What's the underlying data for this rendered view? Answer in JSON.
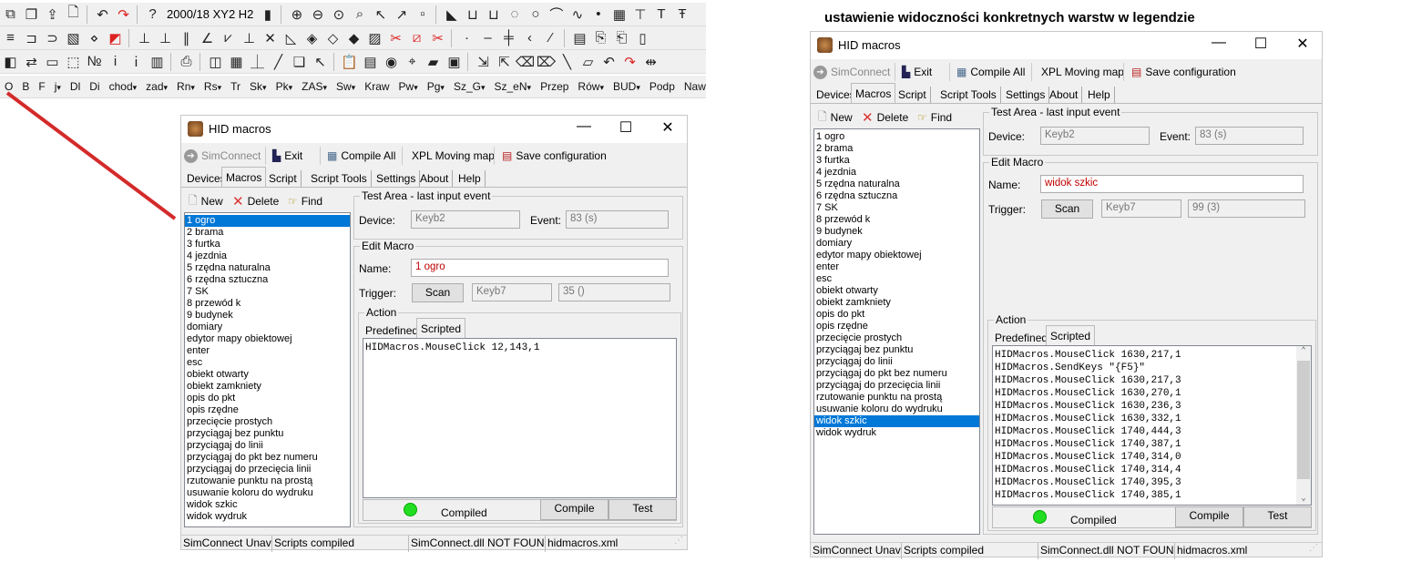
{
  "annotation": {
    "title": "ustawienie widoczności konkretnych warstw w legendzie",
    "arrow_color": "#d42a2a"
  },
  "app_toolbar": {
    "row1": [
      "copy-layers-icon",
      "window-cascade-icon",
      "export-icon",
      "document-icon",
      "|",
      "undo-icon",
      "redo-icon",
      "|",
      "help-icon",
      "TEXT",
      "exit-icon",
      "|",
      "zoom-in-icon",
      "zoom-out-icon",
      "zoom-fit-icon",
      "zoom-window-icon",
      "zoom-prev-icon",
      "zoom-next-icon",
      "frame-icon",
      "|",
      "shape-fill-icon",
      "shape-outline-icon",
      "shape-open-icon",
      "arc-dashed-icon",
      "circle-icon",
      "arc-icon",
      "curve-icon",
      "point-icon",
      "gradient-icon",
      "dimension-icon",
      "text-icon",
      "text-sub-icon"
    ],
    "row1_text": "2000/18 XY2 H2",
    "row2": [
      "line-style-icon",
      "polyline-end-icon",
      "polyline-arc-icon",
      "hatch-icon",
      "hatch-dropdown-icon",
      "fill-color-icon",
      "|",
      "perpendicular-icon",
      "perpendicular-base-icon",
      "parallel-icon",
      "angle-icon",
      "bisector-icon",
      "offset-icon",
      "intersect-icon",
      "area-icon",
      "diamond-hatch-icon",
      "diamond-icon",
      "rhombus-icon",
      "stripes-icon",
      "cut-icon",
      "square-cut-icon",
      "scissors-icon",
      "|",
      "point-on-line-icon",
      "midline-icon",
      "split-icon",
      "angle-point-icon",
      "extend-icon",
      "|",
      "table-icon",
      "copy-attr-icon",
      "paste-attr-icon",
      "attr-icon"
    ],
    "row3": [
      "layer-k1-icon",
      "swap-icon",
      "page-icon",
      "selection-icon",
      "numbering-icon",
      "info-icon",
      "info-list-icon",
      "sw-be-icon",
      "|",
      "print-icon",
      "|",
      "layers-icon",
      "grid-icon",
      "measure-icon",
      "line-icon",
      "copy-icon",
      "cursor-icon",
      "|",
      "clipboard-icon",
      "report-icon",
      "map-pin-icon",
      "gps-icon",
      "folder-image-icon",
      "save-doc-icon",
      "|",
      "import-icon",
      "export-layer-icon",
      "eraser-blue-icon",
      "eraser-icon",
      "line-diagonal-icon",
      "parallelogram-icon",
      "undo-yellow-icon",
      "redo-yellow-icon",
      "move-icon"
    ],
    "row4": [
      {
        "label": "O",
        "dd": false
      },
      {
        "label": "B",
        "dd": false
      },
      {
        "label": "F",
        "dd": false
      },
      {
        "label": "j",
        "dd": true
      },
      {
        "label": "Dl",
        "dd": false
      },
      {
        "label": "Di",
        "dd": false
      },
      {
        "label": "chod",
        "dd": true
      },
      {
        "label": "zad",
        "dd": true
      },
      {
        "label": "Rn",
        "dd": true
      },
      {
        "label": "Rs",
        "dd": true
      },
      {
        "label": "Tr",
        "dd": false
      },
      {
        "label": "Sk",
        "dd": true
      },
      {
        "label": "Pk",
        "dd": true
      },
      {
        "label": "ZAS",
        "dd": true
      },
      {
        "label": "Sw",
        "dd": true
      },
      {
        "label": "Kraw",
        "dd": false
      },
      {
        "label": "Pw",
        "dd": true
      },
      {
        "label": "Pg",
        "dd": true
      },
      {
        "label": "Sz_G",
        "dd": true
      },
      {
        "label": "Sz_eN",
        "dd": true
      },
      {
        "label": "Przep",
        "dd": false
      },
      {
        "label": "Rów",
        "dd": true
      },
      {
        "label": "BUD",
        "dd": true
      },
      {
        "label": "Podp",
        "dd": false
      },
      {
        "label": "Naw",
        "dd": false
      }
    ],
    "dropdown_glyph": "▾"
  },
  "windows": [
    {
      "title": "HID macros",
      "controls": {
        "minimize": "—",
        "maximize": "☐",
        "close": "✕"
      },
      "toolbar": {
        "simconnect": "SimConnect",
        "exit": "Exit",
        "compile_all": "Compile All",
        "xpl": "XPL Moving map",
        "save": "Save configuration"
      },
      "tabs": [
        "Devices",
        "Macros",
        "Script",
        "Script Tools",
        "Settings",
        "About",
        "Help"
      ],
      "active_tab": 1,
      "list_toolbar": {
        "new": "New",
        "delete": "Delete",
        "find": "Find"
      },
      "macros": [
        "1 ogro",
        "2 brama",
        "3 furtka",
        "4 jezdnia",
        "5 rzędna naturalna",
        "6 rzędna sztuczna",
        "7 SK",
        "8 przewód k",
        "9 budynek",
        "domiary",
        "edytor mapy obiektowej",
        "enter",
        "esc",
        "obiekt otwarty",
        "obiekt zamkniety",
        "opis do pkt",
        "opis rzędne",
        "przecięcie prostych",
        "przyciągaj bez punktu",
        "przyciągaj do linii",
        "przyciągaj do pkt bez numeru",
        "przyciągaj do przecięcia linii",
        "rzutowanie punktu na prostą",
        "usuwanie koloru do wydruku",
        "widok szkic",
        "widok wydruk"
      ],
      "selected_macro": 0,
      "test_area": {
        "label": "Test Area - last input event",
        "device_label": "Device:",
        "device": "Keyb2",
        "event_label": "Event:",
        "event": "83  (s)"
      },
      "edit": {
        "label": "Edit Macro",
        "name_label": "Name:",
        "name": "1 ogro",
        "trigger_label": "Trigger:",
        "scan": "Scan",
        "trigger_device": "Keyb7",
        "trigger_value": "35  ()"
      },
      "action": {
        "label": "Action",
        "tabs": [
          "Predefined",
          "Scripted"
        ],
        "active_tab": 1,
        "code": [
          "HIDMacros.MouseClick 12,143,1"
        ],
        "status": "Compiled",
        "compile": "Compile",
        "test": "Test",
        "has_scrollbar": false
      },
      "statusbar": [
        "SimConnect Unavai",
        "Scripts compiled",
        "SimConnect.dll NOT FOUNI",
        "hidmacros.xml"
      ]
    },
    {
      "title": "HID macros",
      "controls": {
        "minimize": "—",
        "maximize": "☐",
        "close": "✕"
      },
      "toolbar": {
        "simconnect": "SimConnect",
        "exit": "Exit",
        "compile_all": "Compile All",
        "xpl": "XPL Moving map",
        "save": "Save configuration"
      },
      "tabs": [
        "Devices",
        "Macros",
        "Script",
        "Script Tools",
        "Settings",
        "About",
        "Help"
      ],
      "active_tab": 1,
      "list_toolbar": {
        "new": "New",
        "delete": "Delete",
        "find": "Find"
      },
      "macros": [
        "1 ogro",
        "2 brama",
        "3 furtka",
        "4 jezdnia",
        "5 rzędna naturalna",
        "6 rzędna sztuczna",
        "7 SK",
        "8 przewód k",
        "9 budynek",
        "domiary",
        "edytor mapy obiektowej",
        "enter",
        "esc",
        "obiekt otwarty",
        "obiekt zamkniety",
        "opis do pkt",
        "opis rzędne",
        "przecięcie prostych",
        "przyciągaj bez punktu",
        "przyciągaj do linii",
        "przyciągaj do pkt bez numeru",
        "przyciągaj do przecięcia linii",
        "rzutowanie punktu na prostą",
        "usuwanie koloru do wydruku",
        "widok szkic",
        "widok wydruk"
      ],
      "selected_macro": 24,
      "test_area": {
        "label": "Test Area - last input event",
        "device_label": "Device:",
        "device": "Keyb2",
        "event_label": "Event:",
        "event": "83  (s)"
      },
      "edit": {
        "label": "Edit Macro",
        "name_label": "Name:",
        "name": "widok szkic",
        "trigger_label": "Trigger:",
        "scan": "Scan",
        "trigger_device": "Keyb7",
        "trigger_value": "99  (3)"
      },
      "action": {
        "label": "Action",
        "tabs": [
          "Predefined",
          "Scripted"
        ],
        "active_tab": 1,
        "code": [
          "HIDMacros.MouseClick 1630,217,1",
          "HIDMacros.SendKeys \"{F5}\"",
          "HIDMacros.MouseClick 1630,217,3",
          "HIDMacros.MouseClick 1630,270,1",
          "HIDMacros.MouseClick 1630,236,3",
          "HIDMacros.MouseClick 1630,332,1",
          "HIDMacros.MouseClick 1740,444,3",
          "HIDMacros.MouseClick 1740,387,1",
          "HIDMacros.MouseClick 1740,314,0",
          "HIDMacros.MouseClick 1740,314,4",
          "HIDMacros.MouseClick 1740,395,3",
          "HIDMacros.MouseClick 1740,385,1"
        ],
        "status": "Compiled",
        "compile": "Compile",
        "test": "Test",
        "has_scrollbar": true
      },
      "statusbar": [
        "SimConnect Unavai",
        "Scripts compiled",
        "SimConnect.dll NOT FOUNI",
        "hidmacros.xml"
      ]
    }
  ],
  "colors": {
    "selection": "#0078d7",
    "compiled_light": "#22dd22",
    "name_text": "#c00000"
  }
}
